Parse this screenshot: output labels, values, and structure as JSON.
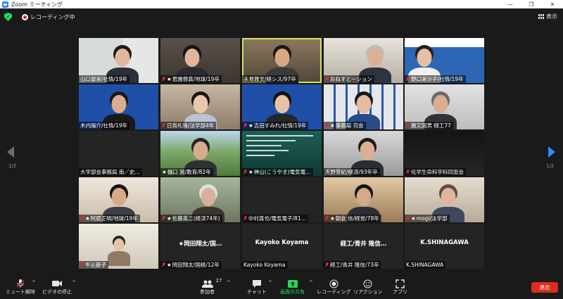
{
  "window": {
    "title": "Zoom ミーティング",
    "controls": [
      "—",
      "❐",
      "✕"
    ]
  },
  "status": {
    "recording": "レコーディング中",
    "view_label": "表示"
  },
  "pager": {
    "left": "1/2",
    "right": "1/2"
  },
  "participants": [
    {
      "name": "山口留実/社情/19年",
      "mic_muted": false,
      "star": false
    },
    {
      "name": "君園僚真/地球/19卒",
      "mic_muted": true,
      "star": true
    },
    {
      "name": "永易雅文/経シス/97卒",
      "mic_muted": false,
      "star": false
    },
    {
      "name": "おねすとーション",
      "mic_muted": true,
      "star": false
    },
    {
      "name": "野口実沙子/社情/19年",
      "mic_muted": true,
      "star": false
    },
    {
      "name": "木内陽介/社情/19年",
      "mic_muted": false,
      "star": false
    },
    {
      "name": "日鳥礼珠/法学部4年",
      "mic_muted": true,
      "star": false
    },
    {
      "name": "吉田すみれ/社情/19年",
      "mic_muted": true,
      "star": true
    },
    {
      "name": "事務局 司会",
      "mic_muted": true,
      "star": true
    },
    {
      "name": "勝又国男 経工77",
      "mic_muted": true,
      "star": false
    },
    {
      "name": "大学部会事務局 南／史…",
      "mic_muted": false,
      "star": false
    },
    {
      "name": "樋口 晃/教育/82年",
      "mic_muted": false,
      "star": true
    },
    {
      "name": "神山(こうやま)電気電…",
      "mic_muted": true,
      "star": true
    },
    {
      "name": "天野景紀/経済/93年卒",
      "mic_muted": false,
      "star": false
    },
    {
      "name": "化学生命科学科同窓会",
      "mic_muted": true,
      "star": false
    },
    {
      "name": "阿原正明/地球/19年",
      "mic_muted": true,
      "star": true
    },
    {
      "name": "佐藤英二(経済74年)",
      "mic_muted": true,
      "star": true
    },
    {
      "name": "中村真也/電気電子/81…",
      "mic_muted": true,
      "star": false
    },
    {
      "name": "朝倉 信/経営/78年",
      "mic_muted": true,
      "star": true
    },
    {
      "name": "mogi/法学部",
      "mic_muted": true,
      "star": true
    },
    {
      "name": "牛込節子",
      "mic_muted": true,
      "star": false
    },
    {
      "name": "岡田翔太/国経/12年",
      "mic_muted": true,
      "star": true,
      "center_name": "★岡田翔太/国…"
    },
    {
      "name": "Kayoko Koyama",
      "mic_muted": false,
      "star": false,
      "center_name": "Kayoko Koyama"
    },
    {
      "name": "経工/青井 隆信/73卒",
      "mic_muted": true,
      "star": false,
      "center_name": "経工/青井 隆信…"
    },
    {
      "name": "K.SHINAGAWA",
      "mic_muted": false,
      "star": false,
      "center_name": "K.SHINAGAWA"
    }
  ],
  "toolbar": {
    "mute": "ミュート解除",
    "video": "ビデオの停止",
    "participants": "参加者",
    "participants_count": "27",
    "chat": "チャット",
    "share": "画面の共有",
    "record": "レコーディング",
    "reactions": "リアクション",
    "apps": "アプリ",
    "end": "退出"
  },
  "colors": {
    "active_border": "#d8e255",
    "share_green": "#23d959",
    "end_red": "#d92d20",
    "zoom_blue": "#2d8cff"
  }
}
